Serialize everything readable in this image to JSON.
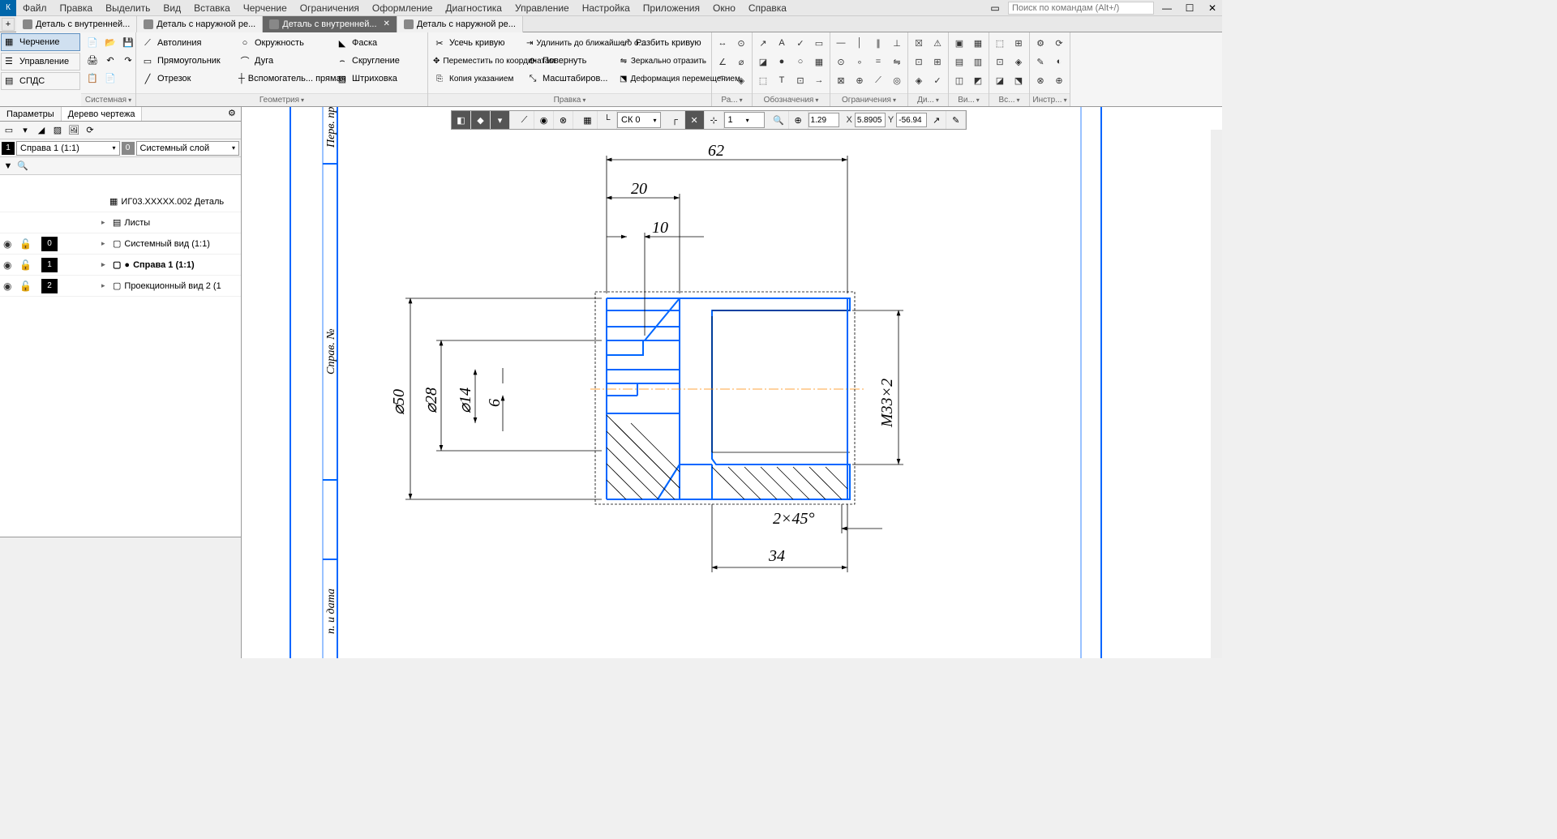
{
  "app": {
    "search_placeholder": "Поиск по командам (Alt+/)"
  },
  "menu": [
    "Файл",
    "Правка",
    "Выделить",
    "Вид",
    "Вставка",
    "Черчение",
    "Ограничения",
    "Оформление",
    "Диагностика",
    "Управление",
    "Настройка",
    "Приложения",
    "Окно",
    "Справка"
  ],
  "tabs": [
    {
      "label": "Деталь с внутренней...",
      "active": false
    },
    {
      "label": "Деталь с наружной ре...",
      "active": false
    },
    {
      "label": "Деталь с внутренней...",
      "active": true
    },
    {
      "label": "Деталь с наружной ре...",
      "active": false
    }
  ],
  "modes": [
    {
      "label": "Черчение",
      "active": true
    },
    {
      "label": "Управление",
      "active": false
    },
    {
      "label": "СПДС",
      "active": false
    }
  ],
  "ribbon": {
    "sys_label": "Системная",
    "geom_label": "Геометрия",
    "edit_label": "Правка",
    "dim_label": "Ра...",
    "notes_label": "Обозначения",
    "constr_label": "Ограничения",
    "diag_label": "Ди...",
    "view_label": "Ви...",
    "ins_label": "Вс...",
    "tools_label": "Инстр...",
    "geom": {
      "autoline": "Автолиния",
      "circle": "Окружность",
      "chamfer": "Фаска",
      "rect": "Прямоугольник",
      "arc": "Дуга",
      "fillet": "Скругление",
      "segment": "Отрезок",
      "aux": "Вспомогатель...\nпрямая",
      "hatch": "Штриховка"
    },
    "edit": {
      "trim": "Усечь кривую",
      "extend": "Удлинить до ближайшего о...",
      "split": "Разбить кривую",
      "move": "Переместить по координатам",
      "rotate": "Повернуть",
      "mirror": "Зеркально отразить",
      "copy": "Копия указанием",
      "scale": "Масштабиров...",
      "deform": "Деформация перемещением"
    }
  },
  "panel": {
    "tab_params": "Параметры",
    "tab_tree": "Дерево чертежа",
    "view_num": "1",
    "view_combo": "Справа 1 (1:1)",
    "layer_num": "0",
    "layer_combo": "Системный слой",
    "root": "ИГ03.ХХХХХ.002 Деталь",
    "rows": [
      {
        "label": "Листы",
        "chevron": "▸",
        "icon": "sheets"
      },
      {
        "label": "Системный вид (1:1)",
        "chevron": "▸",
        "icon": "view",
        "num": "0",
        "eye": true
      },
      {
        "label": "Справа 1 (1:1)",
        "chevron": "▸",
        "icon": "view",
        "num": "1",
        "eye": true,
        "bold": true,
        "dot": true
      },
      {
        "label": "Проекционный вид 2 (1",
        "chevron": "▸",
        "icon": "view",
        "num": "2",
        "eye": true
      }
    ]
  },
  "toolbar": {
    "ck_combo": "СК 0",
    "scale_combo": "1",
    "zoom": "1.29",
    "x_label": "X",
    "x_val": "5.8905",
    "y_label": "Y",
    "y_val": "-56.94"
  },
  "drawing": {
    "dims": {
      "d62": "62",
      "d20": "20",
      "d10": "10",
      "d50": "⌀50",
      "d28": "⌀28",
      "d14": "⌀14",
      "d6": "6",
      "m33": "M33×2",
      "chamfer": "2×45°",
      "d34": "34"
    },
    "frame": {
      "col1": "Перв. пр",
      "col2": "Справ. №",
      "col3": "п. и дата"
    }
  }
}
